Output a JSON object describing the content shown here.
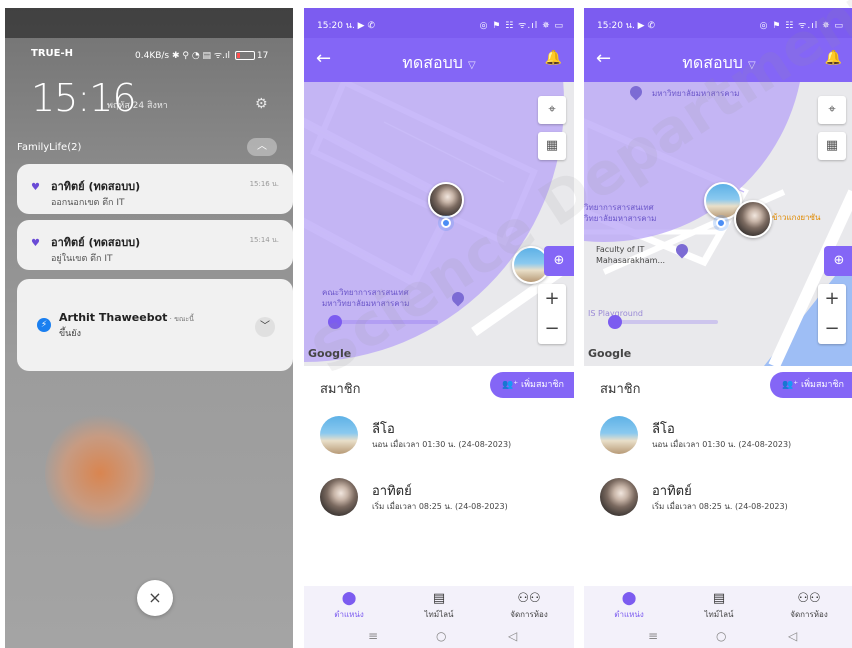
{
  "notif_shade": {
    "carrier": "TRUE-H",
    "sysinfo": "0.4KB/s ✱ ⚲ ◔ ▤ ᯤ.ıl",
    "battery": "17",
    "time": "15:16",
    "date": "พฤหัส 24 สิงหา",
    "group_title": "FamilyLife(2)",
    "notifications": [
      {
        "title": "อาทิตย์ (ทดสอบบ)",
        "body": "ออกนอกเขต ตึก IT",
        "time": "15:16 น."
      },
      {
        "title": "อาทิตย์ (ทดสอบบ)",
        "body": "อยู่ในเขต ตึก IT",
        "time": "15:14 น."
      }
    ],
    "messenger": {
      "sender": "Arthit Thaweebot",
      "suffix": " · ขณะนี้",
      "body": "ขึ้นยัง"
    },
    "close_glyph": "×"
  },
  "app_screens": [
    {
      "status_time": "15:20 น. ▶ ✆",
      "status_icons": "◎ ⚑ ☷ ᯤ.ıl ✵ ▭",
      "title": "ทดสอบบ",
      "map_labels": [
        "คณะวิทยาการสารสนเทศ",
        "มหาวิทยาลัยมหาสารคาม"
      ],
      "members_title": "สมาชิก",
      "add_member": "เพิ่มสมาชิก",
      "members": [
        {
          "name": "ลีโอ",
          "status": "นอน เมื่อเวลา 01:30 น. (24-08-2023)"
        },
        {
          "name": "อาทิตย์",
          "status": "เริ่ม เมื่อเวลา 08:25 น. (24-08-2023)"
        }
      ],
      "nav": [
        "ตำแหน่ง",
        "ไทม์ไลน์",
        "จัดการห้อง"
      ]
    },
    {
      "status_time": "15:20 น. ▶ ✆",
      "status_icons": "◎ ⚑ ☷ ᯤ.ıl ✵ ▭",
      "title": "ทดสอบบ",
      "map_labels": [
        "มหาวิทยาลัยมหาสารคาม",
        "วิทยาการสารสนเทศ",
        "วิทยาลัยมหาสารคาม",
        "Faculty of IT",
        "Mahasarakham...",
        "IS Playground",
        "ข้าวแกงยาซัน"
      ],
      "members_title": "สมาชิก",
      "add_member": "เพิ่มสมาชิก",
      "members": [
        {
          "name": "ลีโอ",
          "status": "นอน เมื่อเวลา 01:30 น. (24-08-2023)"
        },
        {
          "name": "อาทิตย์",
          "status": "เริ่ม เมื่อเวลา 08:25 น. (24-08-2023)"
        }
      ],
      "nav": [
        "ตำแหน่ง",
        "ไทม์ไลน์",
        "จัดการห้อง"
      ]
    }
  ],
  "map_attribution": "Google",
  "icons": {
    "back": "arrow-left-icon",
    "bell": "bell-icon",
    "locate": "crosshair-icon",
    "layers": "map-icon",
    "add_place": "map-pin-plus-icon",
    "nav_location": "location-pin-icon",
    "nav_timeline": "note-icon",
    "nav_room": "group-icon"
  },
  "colors": {
    "accent": "#8466f6",
    "accent_dark": "#7c5cf0",
    "geofence": "#b7a3f7",
    "water": "#9ebef5"
  },
  "watermark": "Science Department, Mahasarakham Uni"
}
